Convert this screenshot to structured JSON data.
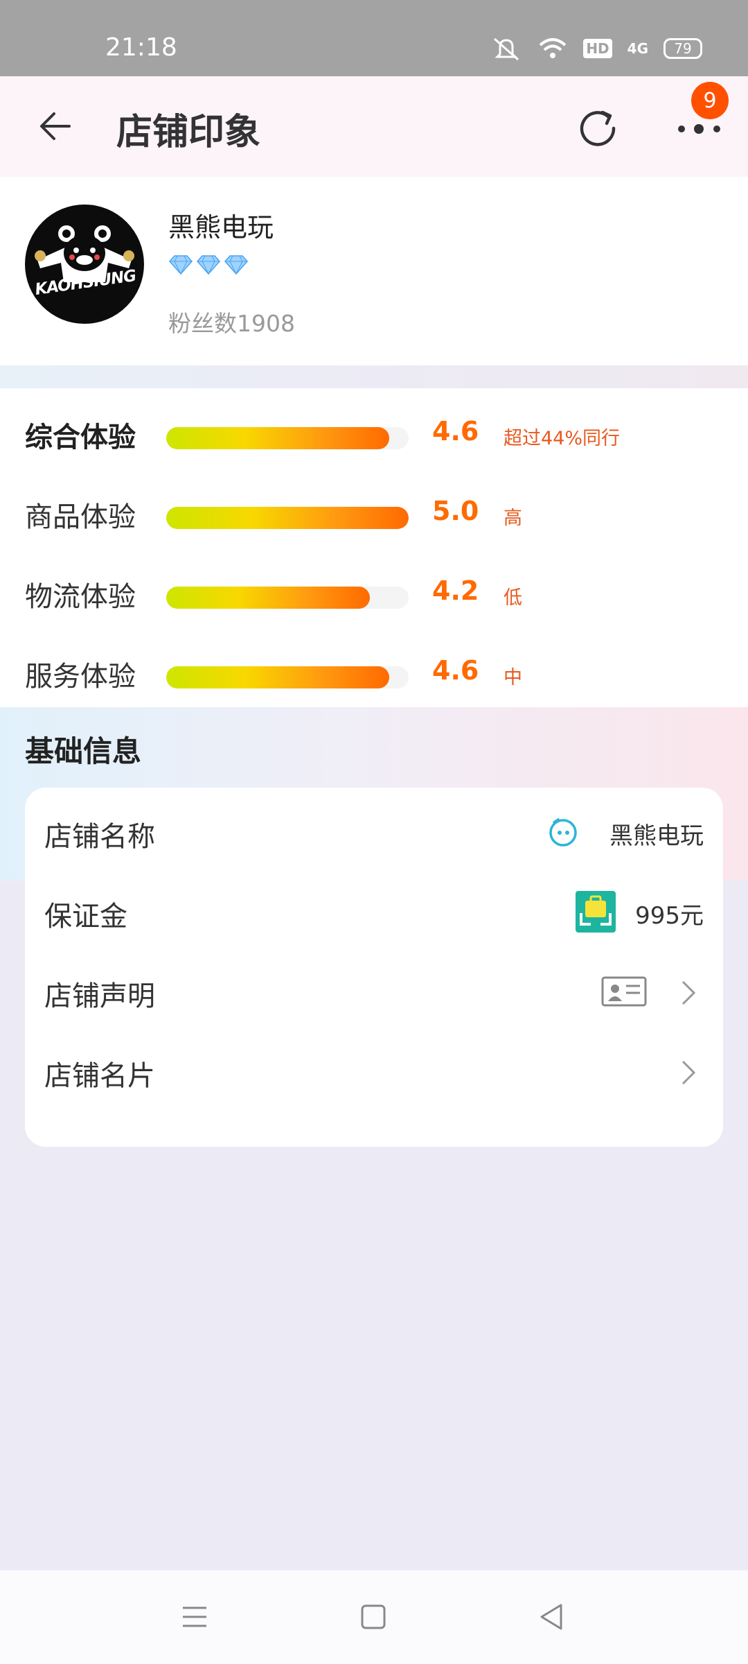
{
  "status_bar": {
    "time": "21:18",
    "network": "4G",
    "hd": "HD",
    "battery": "79"
  },
  "header": {
    "title": "店铺印象",
    "notification_count": "9"
  },
  "shop": {
    "name": "黑熊电玩",
    "fans": "粉丝数1908",
    "avatar_text": "KAOHSIUNG",
    "diamond_level": 3
  },
  "ratings": [
    {
      "label": "综合体验",
      "score": "4.6",
      "note": "超过44%同行",
      "fill_percent": 92
    },
    {
      "label": "商品体验",
      "score": "5.0",
      "note": "高",
      "fill_percent": 100
    },
    {
      "label": "物流体验",
      "score": "4.2",
      "note": "低",
      "fill_percent": 84
    },
    {
      "label": "服务体验",
      "score": "4.6",
      "note": "中",
      "fill_percent": 92
    }
  ],
  "basic_info": {
    "title": "基础信息",
    "rows": [
      {
        "label": "店铺名称",
        "value": "黑熊电玩",
        "icon": "smiley-icon"
      },
      {
        "label": "保证金",
        "value": "995元",
        "icon": "deposit-icon"
      },
      {
        "label": "店铺声明",
        "value": "",
        "icon": "id-card-icon"
      },
      {
        "label": "店铺名片",
        "value": "",
        "icon": ""
      }
    ]
  },
  "colors": {
    "accent": "#ff6a00",
    "badge": "#ff5000",
    "deposit": "#1db59f"
  }
}
